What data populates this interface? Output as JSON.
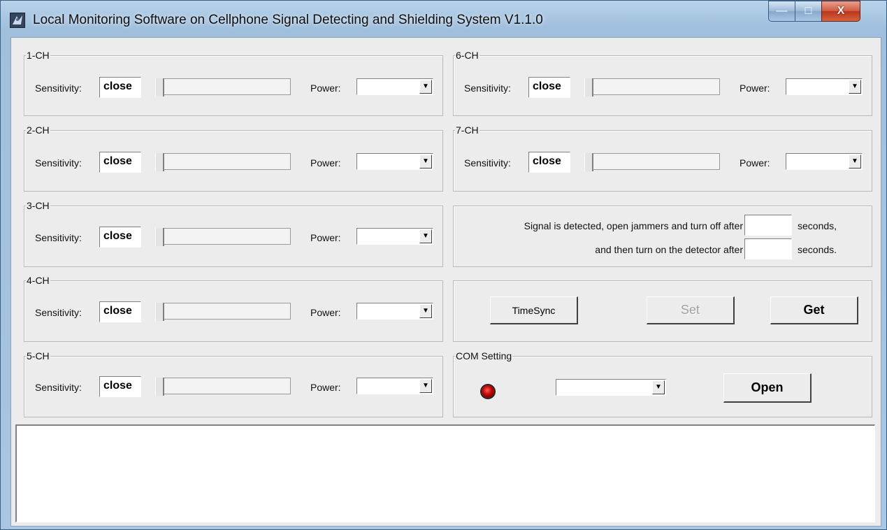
{
  "window": {
    "title": "Local Monitoring Software on Cellphone Signal Detecting and Shielding System V1.1.0",
    "controls": {
      "minimize": "—",
      "maximize": "□",
      "close": "X"
    }
  },
  "labels": {
    "sensitivity": "Sensitivity:",
    "power": "Power:"
  },
  "channels": [
    {
      "name": "1-CH",
      "sensitivity_value": "close",
      "power_value": ""
    },
    {
      "name": "2-CH",
      "sensitivity_value": "close",
      "power_value": ""
    },
    {
      "name": "3-CH",
      "sensitivity_value": "close",
      "power_value": ""
    },
    {
      "name": "4-CH",
      "sensitivity_value": "close",
      "power_value": ""
    },
    {
      "name": "5-CH",
      "sensitivity_value": "close",
      "power_value": ""
    },
    {
      "name": "6-CH",
      "sensitivity_value": "close",
      "power_value": ""
    },
    {
      "name": "7-CH",
      "sensitivity_value": "close",
      "power_value": ""
    }
  ],
  "timer": {
    "line1_prefix": "Signal is detected, open jammers and turn off after",
    "line1_suffix": "seconds,",
    "line1_value": "",
    "line2_prefix": "and then turn on the detector after",
    "line2_suffix": "seconds.",
    "line2_value": ""
  },
  "actions": {
    "timesync": "TimeSync",
    "set": "Set",
    "get": "Get"
  },
  "com": {
    "group_label": "COM Setting",
    "port_value": "",
    "open_button": "Open",
    "status_color": "#cc0000"
  },
  "log": {
    "text": ""
  }
}
